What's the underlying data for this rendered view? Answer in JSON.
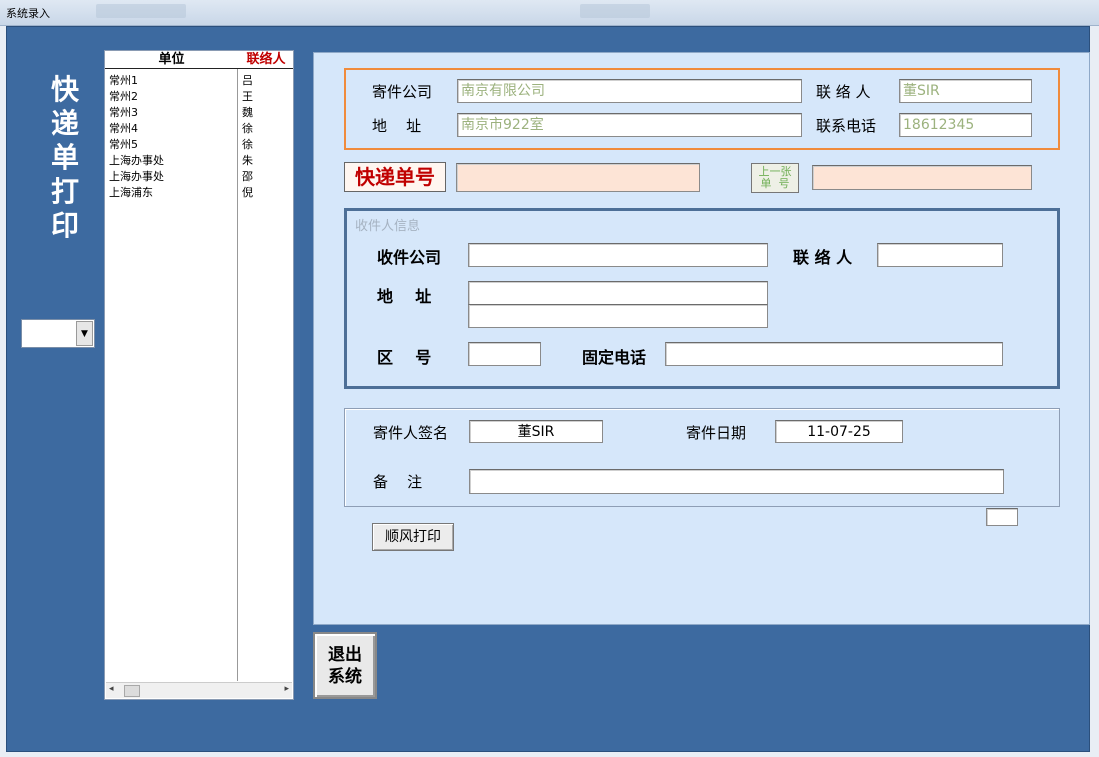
{
  "window": {
    "title": "系统录入"
  },
  "side_title": [
    "快",
    "递",
    "单",
    "打",
    "印"
  ],
  "side_combo": {
    "value": ""
  },
  "list": {
    "headers": {
      "unit": "单位",
      "contact": "联络人"
    },
    "rows": [
      {
        "unit": "常州1",
        "contact": "吕"
      },
      {
        "unit": "常州2",
        "contact": "王"
      },
      {
        "unit": "常州3",
        "contact": "魏"
      },
      {
        "unit": "常州4",
        "contact": "徐"
      },
      {
        "unit": "常州5",
        "contact": "徐"
      },
      {
        "unit": "上海办事处",
        "contact": "朱"
      },
      {
        "unit": "上海办事处",
        "contact": "邵"
      },
      {
        "unit": "上海浦东",
        "contact": "倪"
      }
    ]
  },
  "sender": {
    "company_label": "寄件公司",
    "company_value": "南京有限公司",
    "contact_label": "联 络 人",
    "contact_value": "董SIR",
    "address_label": "地    址",
    "address_value": "南京市922室",
    "phone_label": "联系电话",
    "phone_value": "18612345"
  },
  "tracking": {
    "label": "快递单号",
    "value": "",
    "prev_label_line1": "上一张",
    "prev_label_line2": "单  号",
    "prev_value": ""
  },
  "receiver": {
    "legend": "收件人信息",
    "company_label": "收件公司",
    "company_value": "",
    "contact_label": "联 络 人",
    "contact_value": "",
    "address_label": "地    址",
    "address_line1": "",
    "address_line2": "",
    "area_code_label": "区    号",
    "area_code_value": "",
    "phone_label": "固定电话",
    "phone_value": ""
  },
  "signature": {
    "signer_label": "寄件人签名",
    "signer_value": "董SIR",
    "date_label": "寄件日期",
    "date_value": "11-07-25",
    "remark_label": "备    注",
    "remark_value": ""
  },
  "small_box_value": "",
  "buttons": {
    "sf_print": "顺风打印",
    "exit_line1": "退出",
    "exit_line2": "系统"
  }
}
